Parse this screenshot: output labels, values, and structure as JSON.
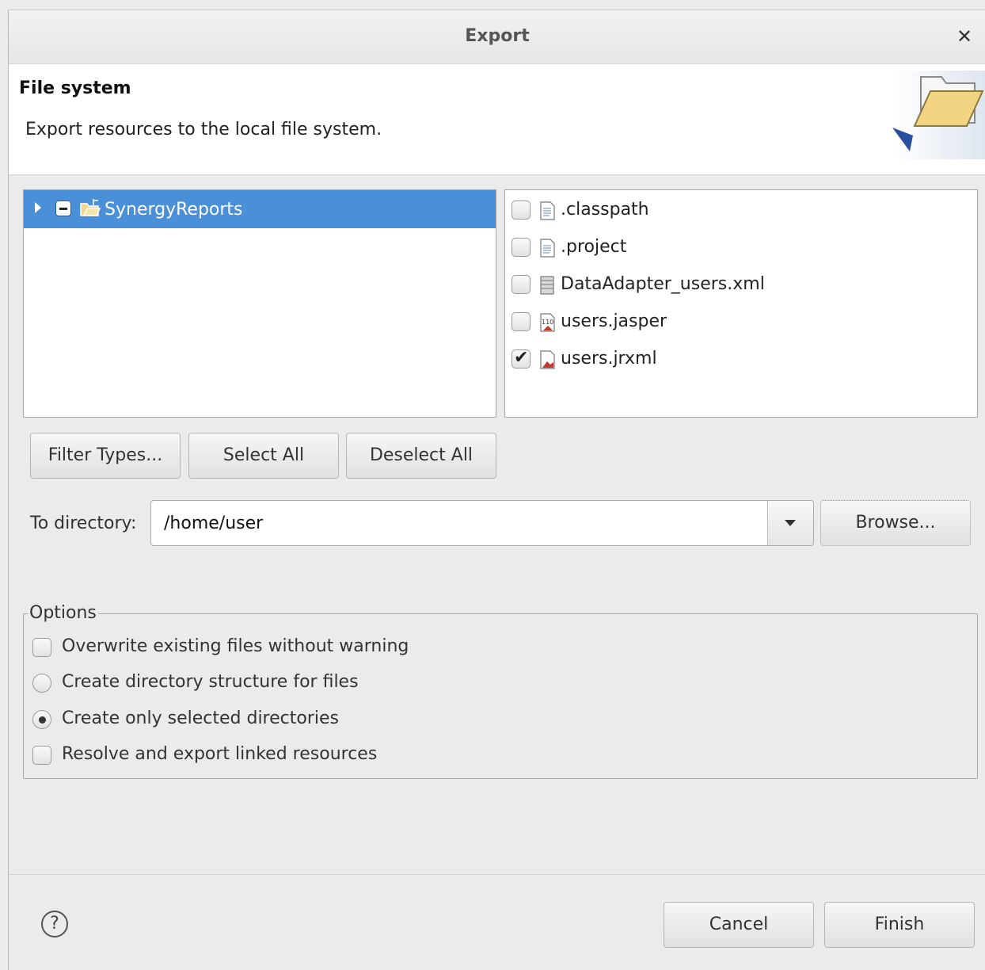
{
  "window": {
    "title": "Export",
    "close_icon": "✕"
  },
  "header": {
    "title": "File system",
    "description": "Export resources to the local file system."
  },
  "tree": {
    "items": [
      {
        "label": "SynergyReports",
        "state": "partial",
        "expanded": false,
        "selected": true
      }
    ]
  },
  "files": {
    "items": [
      {
        "label": ".classpath",
        "checked": false,
        "icon": "text-file-icon"
      },
      {
        "label": ".project",
        "checked": false,
        "icon": "text-file-icon"
      },
      {
        "label": "DataAdapter_users.xml",
        "checked": false,
        "icon": "data-adapter-icon"
      },
      {
        "label": "users.jasper",
        "checked": false,
        "icon": "jasper-file-icon"
      },
      {
        "label": "users.jrxml",
        "checked": true,
        "icon": "jrxml-file-icon"
      }
    ]
  },
  "selection_buttons": {
    "filter_types": "Filter Types...",
    "select_all": "Select All",
    "deselect_all": "Deselect All"
  },
  "destination": {
    "label": "To directory:",
    "value": "/home/user",
    "browse": "Browse..."
  },
  "options": {
    "legend": "Options",
    "overwrite": {
      "label": "Overwrite existing files without warning",
      "checked": false
    },
    "create_structure": {
      "label": "Create directory structure for files",
      "selected": false
    },
    "create_selected": {
      "label": "Create only selected directories",
      "selected": true
    },
    "resolve_linked": {
      "label": "Resolve and export linked resources",
      "checked": false
    }
  },
  "footer": {
    "help_icon": "?",
    "cancel": "Cancel",
    "finish": "Finish"
  },
  "colors": {
    "selection": "#4a90d9",
    "background": "#ebebeb",
    "panel": "#ffffff"
  }
}
